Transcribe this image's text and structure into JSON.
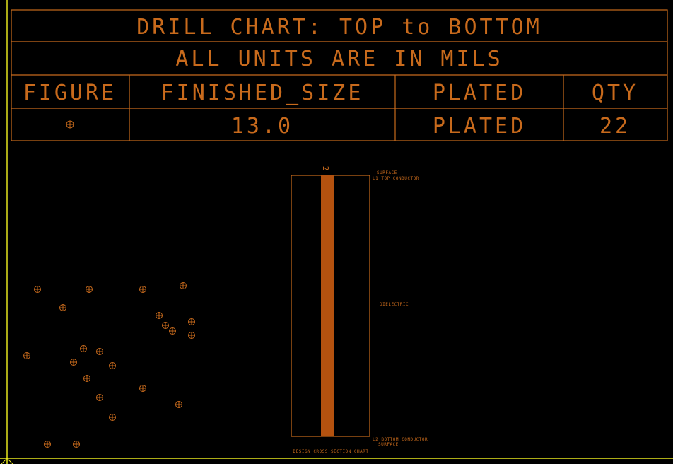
{
  "drill_chart": {
    "title": "DRILL CHART: TOP to BOTTOM",
    "subtitle": "ALL UNITS ARE IN MILS",
    "columns": [
      "FIGURE",
      "FINISHED_SIZE",
      "PLATED",
      "QTY"
    ],
    "rows": [
      {
        "figure_icon": "circle-crosshair",
        "finished_size": "13.0",
        "plated": "PLATED",
        "qty": "22"
      }
    ]
  },
  "cross_section": {
    "via_label": "2",
    "layers": {
      "top_surface": "SURFACE",
      "top_conductor": "L1 TOP CONDUCTOR",
      "dielectric": "DIELECTRIC",
      "bottom_conductor": "L2 BOTTOM CONDUCTOR",
      "bottom_surface": "SURFACE"
    },
    "caption_line1": "DESIGN CROSS SECTION CHART",
    "caption_line2": "...."
  },
  "drill_hits_count": 22,
  "colors": {
    "background": "#000000",
    "cad_orange": "#c86a1c",
    "via_fill": "#b4520f",
    "border_yellow": "#e6e61e"
  }
}
